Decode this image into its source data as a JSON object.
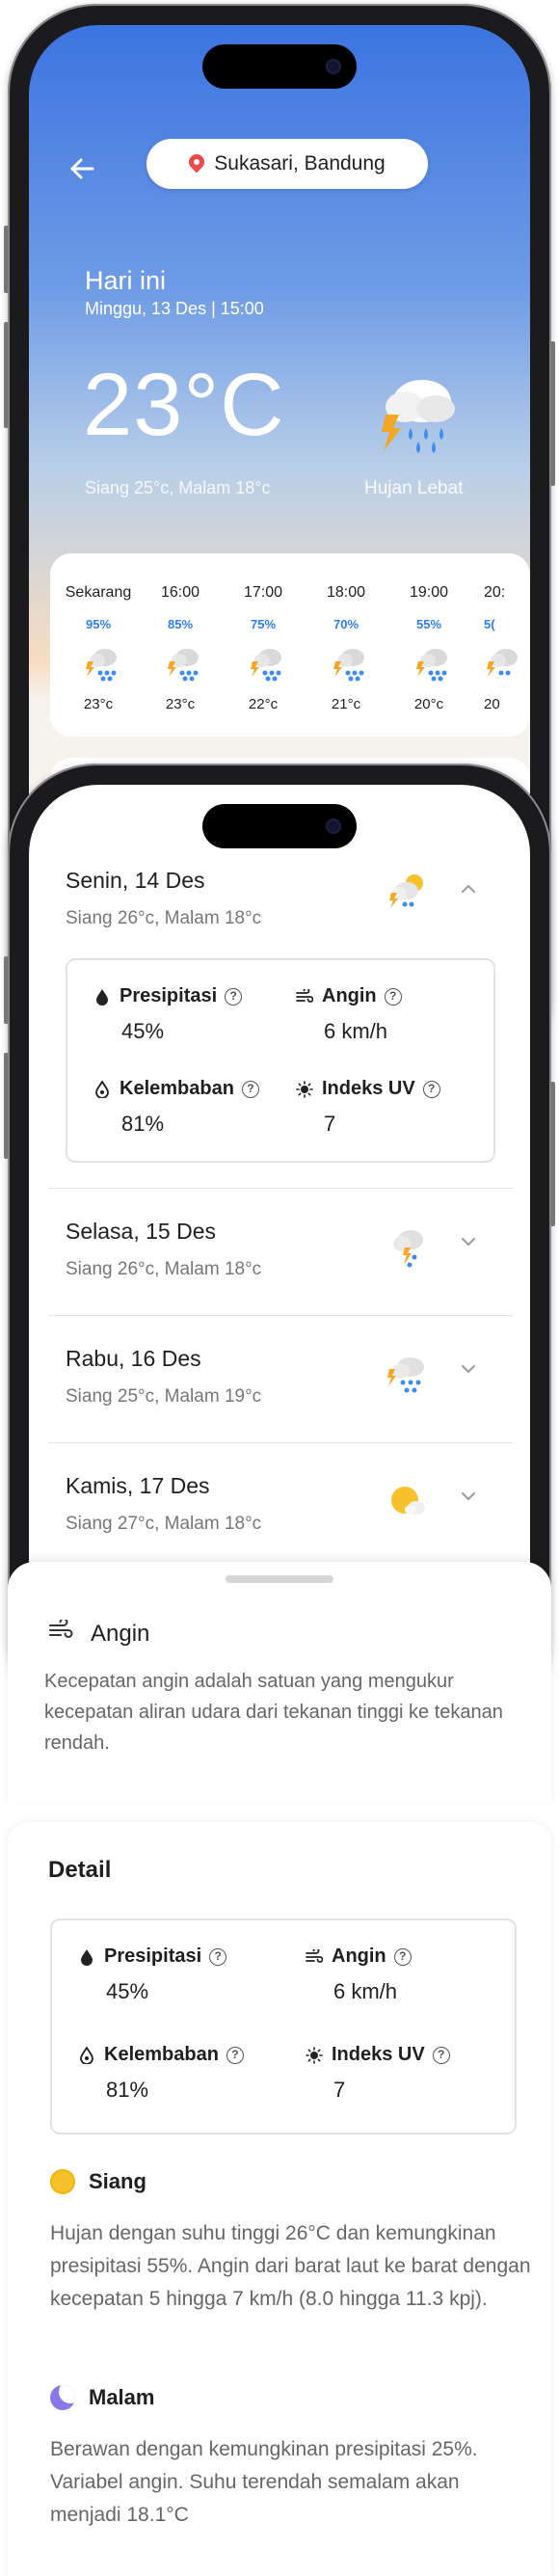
{
  "header": {
    "location": "Sukasari, Bandung",
    "today_label": "Hari ini",
    "date_time": "Minggu, 13 Des | 15:00",
    "temperature": "23°C",
    "day_night_range": "Siang 25°c, Malam 18°c",
    "condition": "Hujan Lebat",
    "condition_icon": "heavy-rain-thunder-icon"
  },
  "hourly": [
    {
      "time": "Sekarang",
      "precip": "95%",
      "temp": "23°c",
      "icon": "rain-thunder-icon"
    },
    {
      "time": "16:00",
      "precip": "85%",
      "temp": "23°c",
      "icon": "rain-thunder-icon"
    },
    {
      "time": "17:00",
      "precip": "75%",
      "temp": "22°c",
      "icon": "rain-thunder-icon"
    },
    {
      "time": "18:00",
      "precip": "70%",
      "temp": "21°c",
      "icon": "rain-thunder-icon"
    },
    {
      "time": "19:00",
      "precip": "55%",
      "temp": "20°c",
      "icon": "rain-thunder-icon"
    },
    {
      "time": "20:",
      "precip": "5(",
      "temp": "20",
      "icon": "rain-thunder-icon"
    }
  ],
  "daily": [
    {
      "day": "Senin, 14 Des",
      "range": "Siang 26°c, Malam 18°c",
      "icon": "partly-cloudy-storm-icon",
      "expanded": true
    },
    {
      "day": "Selasa, 15 Des",
      "range": "Siang 26°c, Malam 18°c",
      "icon": "rain-thunder-icon",
      "expanded": false
    },
    {
      "day": "Rabu, 16 Des",
      "range": "Siang 25°c, Malam 19°c",
      "icon": "heavy-rain-thunder-icon",
      "expanded": false
    },
    {
      "day": "Kamis, 17 Des",
      "range": "Siang 27°c, Malam 18°c",
      "icon": "sun-cloud-icon",
      "expanded": false
    }
  ],
  "metrics": {
    "precip_label": "Presipitasi",
    "precip_value": "45%",
    "wind_label": "Angin",
    "wind_value": "6 km/h",
    "humidity_label": "Kelembaban",
    "humidity_value": "81%",
    "uv_label": "Indeks UV",
    "uv_value": "7"
  },
  "sheet": {
    "title": "Angin",
    "description": "Kecepatan angin adalah satuan yang mengukur kecepatan aliran udara dari tekanan tinggi ke tekanan rendah."
  },
  "detail": {
    "title": "Detail",
    "day_heading": "Siang",
    "day_text": "Hujan dengan suhu tinggi 26°C dan kemungkinan presipitasi 55%. Angin dari barat laut ke barat dengan kecepatan 5 hingga 7 km/h (8.0 hingga 11.3 kpj).",
    "night_heading": "Malam",
    "night_text": "Berawan dengan kemungkinan presipitasi 25%. Variabel angin. Suhu terendah semalam akan menjadi 18.1°C"
  },
  "colors": {
    "accent_blue": "#2d7ff0",
    "sky_top": "#3c74e0",
    "sky_bottom": "#f7dcc1",
    "sun_yellow": "#f6c12a",
    "moon_purple": "#8a78e6"
  }
}
